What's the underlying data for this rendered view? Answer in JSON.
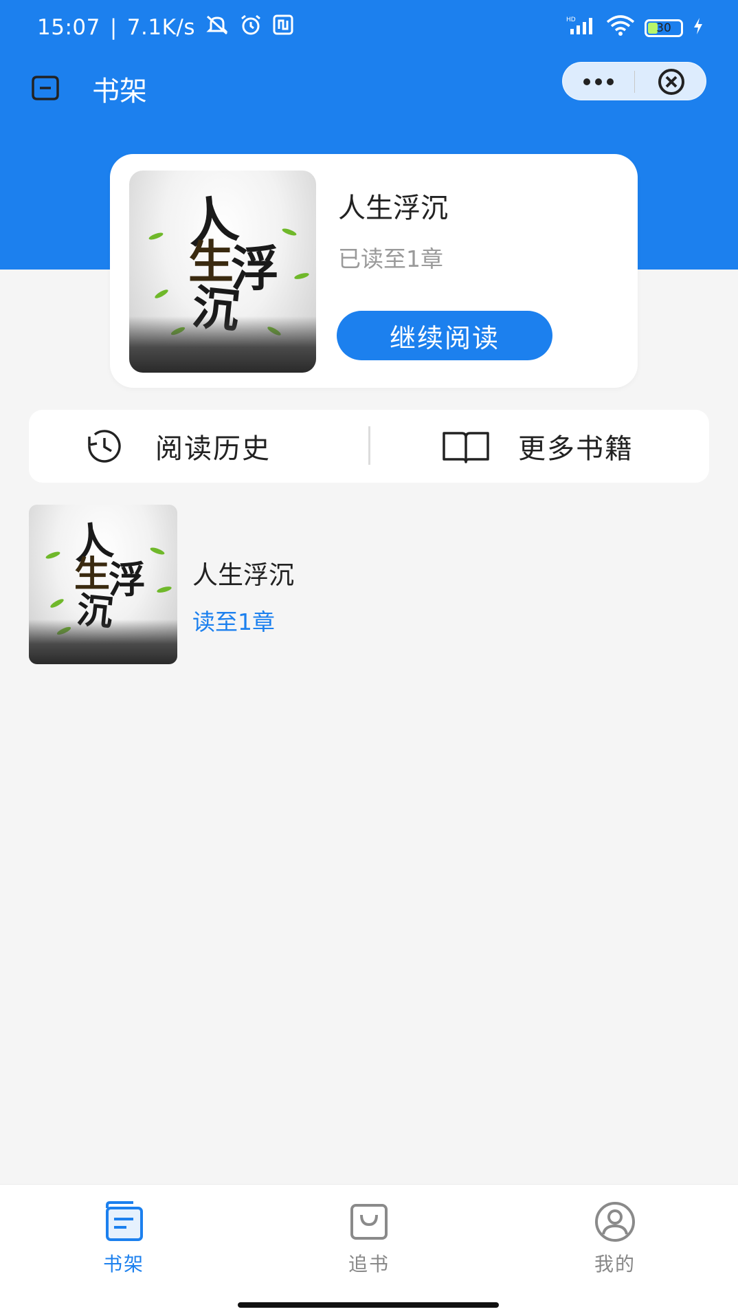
{
  "status_bar": {
    "time": "15:07",
    "network_speed": "7.1K/s",
    "battery_level": "30",
    "icons": [
      "mute-icon",
      "alarm-icon",
      "nfc-icon",
      "hd-signal-icon",
      "wifi-icon",
      "battery-icon",
      "charging-icon"
    ]
  },
  "nav": {
    "title": "书架"
  },
  "featured": {
    "book_title": "人生浮沉",
    "progress": "已读至1章",
    "continue_label": "继续阅读",
    "cover_text": "人生浮沉"
  },
  "actions": {
    "history_label": "阅读历史",
    "more_books_label": "更多书籍"
  },
  "shelf": {
    "items": [
      {
        "title": "人生浮沉",
        "progress": "读至1章",
        "cover_text": "人生浮沉"
      }
    ]
  },
  "tabs": [
    {
      "label": "书架",
      "active": true
    },
    {
      "label": "追书",
      "active": false
    },
    {
      "label": "我的",
      "active": false
    }
  ],
  "colors": {
    "primary": "#1c80ee",
    "background": "#f5f5f5",
    "inactive": "#888888"
  }
}
